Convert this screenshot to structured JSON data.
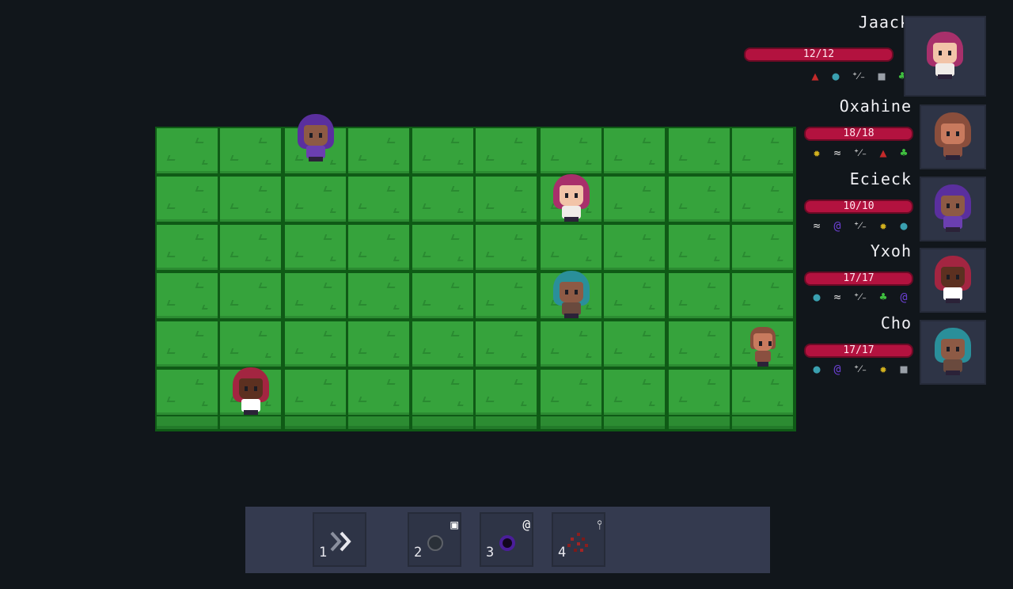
{
  "board": {
    "columns": 10,
    "rows": 6
  },
  "units_on_board": [
    {
      "id": "purple-hair-unit",
      "col": 2,
      "row": 0,
      "hair": "#5a2f9e",
      "skin": "#8d5a45",
      "shirt": "#6b3fb0",
      "size": "large"
    },
    {
      "id": "magenta-hair-unit",
      "col": 6,
      "row": 1,
      "hair": "#a8306b",
      "skin": "#f2c4a8",
      "shirt": "#f0ece8",
      "size": "large"
    },
    {
      "id": "teal-hair-unit",
      "col": 6,
      "row": 3,
      "hair": "#2a8f9a",
      "skin": "#8d5a45",
      "shirt": "#6a4a3e",
      "size": "large"
    },
    {
      "id": "bald-unit",
      "col": 9,
      "row": 4,
      "hair": "#8a4e3c",
      "skin": "#c87a5e",
      "shirt": "#8a5040",
      "size": "small"
    },
    {
      "id": "red-hair-unit",
      "col": 1,
      "row": 5,
      "hair": "#a32541",
      "skin": "#5c3020",
      "shirt": "#ffffff",
      "size": "large"
    }
  ],
  "roster": [
    {
      "name": "Jaack",
      "hp": "12/12",
      "statuses": [
        "blood-icon",
        "potion-icon",
        "plus-minus-icon",
        "shield-icon",
        "clover-icon"
      ],
      "hair": "#a8306b",
      "skin": "#f2c4a8",
      "shirt": "#f0ece8"
    },
    {
      "name": "Oxahine",
      "hp": "18/18",
      "statuses": [
        "sun-icon",
        "wind-icon",
        "plus-minus-icon",
        "blood-icon",
        "clover-icon"
      ],
      "hair": "#8a4e3c",
      "skin": "#c87a5e",
      "shirt": "#8a5040"
    },
    {
      "name": "Ecieck",
      "hp": "10/10",
      "statuses": [
        "wind-icon",
        "spiral-icon",
        "plus-minus-icon",
        "sun-icon",
        "potion-icon"
      ],
      "hair": "#5a2f9e",
      "skin": "#8d5a45",
      "shirt": "#6b3fb0"
    },
    {
      "name": "Yxoh",
      "hp": "17/17",
      "statuses": [
        "potion-icon",
        "wind-icon",
        "plus-minus-icon",
        "clover-icon",
        "spiral-icon"
      ],
      "hair": "#a32541",
      "skin": "#5c3020",
      "shirt": "#ffffff"
    },
    {
      "name": "Cho",
      "hp": "17/17",
      "statuses": [
        "potion-icon",
        "spiral-icon",
        "plus-minus-icon",
        "sun-icon",
        "shield-icon"
      ],
      "hair": "#2a8f9a",
      "skin": "#8d5a45",
      "shirt": "#6a4a3e"
    }
  ],
  "status_glyphs": {
    "blood-icon": {
      "glyph": "▲",
      "color": "#c42a2a"
    },
    "potion-icon": {
      "glyph": "●",
      "color": "#3aa0b0"
    },
    "plus-minus-icon": {
      "glyph": "⁺⁄₋",
      "color": "#ffffff"
    },
    "shield-icon": {
      "glyph": "■",
      "color": "#9aa0a8"
    },
    "clover-icon": {
      "glyph": "♣",
      "color": "#3fbf3f"
    },
    "sun-icon": {
      "glyph": "✹",
      "color": "#d4b21e"
    },
    "wind-icon": {
      "glyph": "≈",
      "color": "#d8d8d8"
    },
    "spiral-icon": {
      "glyph": "@",
      "color": "#6a3fd0"
    }
  },
  "actions": [
    {
      "key": "1",
      "icon": "chevron-right-icon",
      "tag": ""
    },
    {
      "key": "2",
      "icon": "ring-icon",
      "tag": "shield-icon"
    },
    {
      "key": "3",
      "icon": "void-orb-icon",
      "tag": "spiral-icon"
    },
    {
      "key": "4",
      "icon": "scatter-icon",
      "tag": "blood-icon"
    }
  ]
}
